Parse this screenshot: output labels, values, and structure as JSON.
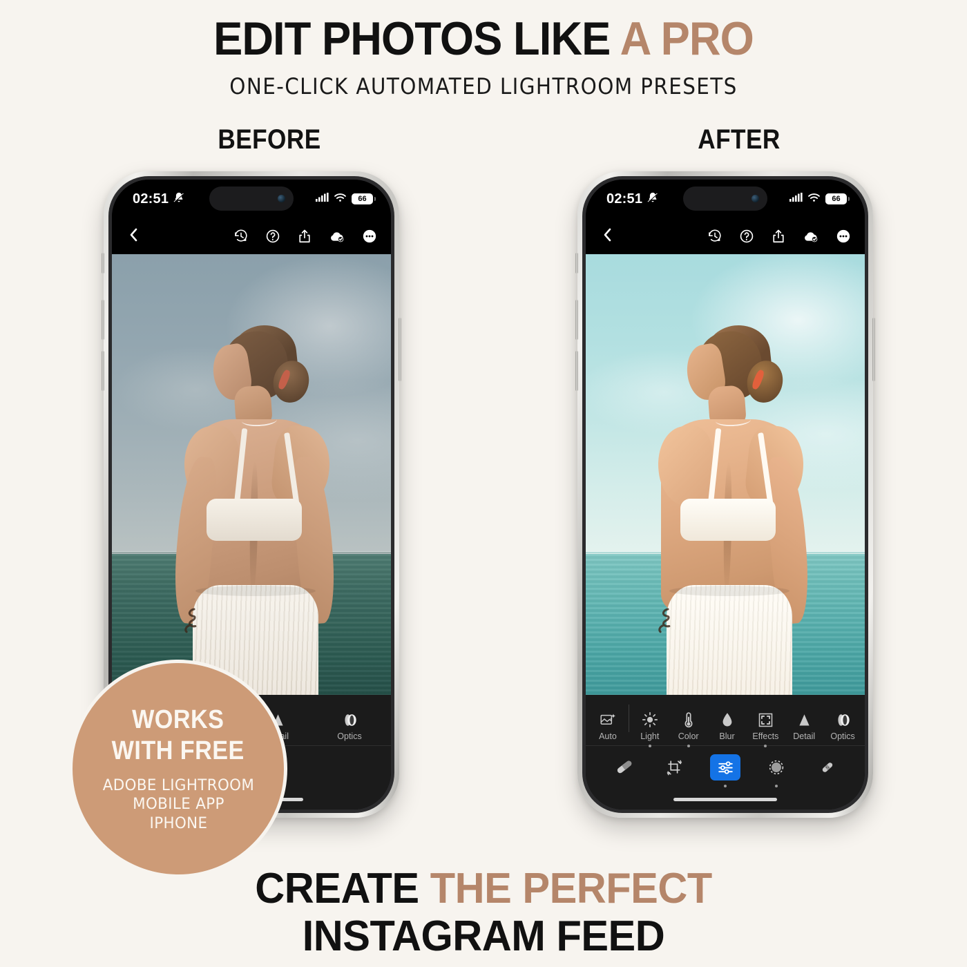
{
  "theme": {
    "background": "#F7F4EF",
    "accent_tan": "#B5866A",
    "badge_bg": "#CD9B77",
    "text_dark": "#111111",
    "lightroom_blue": "#1473E6"
  },
  "header": {
    "title_part1": "EDIT PHOTOS LIKE ",
    "title_accent": "A PRO",
    "subtitle": "ONE-CLICK AUTOMATED LIGHTROOM PRESETS"
  },
  "comparison": {
    "before_label": "BEFORE",
    "after_label": "AFTER"
  },
  "status_bar": {
    "time": "02:51",
    "silent_icon": "bell-slash-icon",
    "signal_icon": "cellular-signal-icon",
    "wifi_icon": "wifi-icon",
    "battery_percent": "66",
    "battery_level": 66
  },
  "app_bar": {
    "back_icon": "chevron-left-icon",
    "actions": [
      {
        "icon": "version-history-icon",
        "name": "version-history-button"
      },
      {
        "icon": "help-circle-icon",
        "name": "help-button"
      },
      {
        "icon": "share-icon",
        "name": "share-button"
      },
      {
        "icon": "cloud-synced-icon",
        "name": "cloud-sync-status"
      },
      {
        "icon": "more-ellipsis-icon",
        "name": "more-options-button"
      }
    ]
  },
  "editor_toolbar": {
    "tools_full": [
      {
        "label": "Auto",
        "icon": "auto-enhance-icon",
        "dot": false
      },
      {
        "label": "Light",
        "icon": "sun-icon",
        "dot": true
      },
      {
        "label": "Color",
        "icon": "thermometer-icon",
        "dot": true
      },
      {
        "label": "Blur",
        "icon": "droplet-icon",
        "dot": false
      },
      {
        "label": "Effects",
        "icon": "frame-brackets-icon",
        "dot": true
      },
      {
        "label": "Detail",
        "icon": "triangle-icon",
        "dot": false
      },
      {
        "label": "Optics",
        "icon": "lens-icon",
        "dot": false
      }
    ],
    "tools_partial": [
      {
        "label": "Effects",
        "icon": "frame-brackets-icon",
        "dot": true
      },
      {
        "label": "Detail",
        "icon": "triangle-icon",
        "dot": false
      },
      {
        "label": "Optics",
        "icon": "lens-icon",
        "dot": false
      }
    ],
    "modes_full": [
      {
        "name": "presets-button",
        "icon": "presets-icon",
        "active": false,
        "dot": false
      },
      {
        "name": "crop-button",
        "icon": "crop-rotate-icon",
        "active": false,
        "dot": false
      },
      {
        "name": "edit-button",
        "icon": "sliders-icon",
        "active": true,
        "dot": true
      },
      {
        "name": "masking-button",
        "icon": "mask-circle-icon",
        "active": false,
        "dot": true
      },
      {
        "name": "healing-button",
        "icon": "healing-brush-icon",
        "active": false,
        "dot": false
      }
    ],
    "modes_partial": [
      {
        "name": "masking-button",
        "icon": "mask-circle-icon",
        "active": false,
        "dot": true
      },
      {
        "name": "healing-button",
        "icon": "healing-brush-icon",
        "active": false,
        "dot": false
      }
    ]
  },
  "badge": {
    "line1": "WORKS",
    "line2": "WITH FREE",
    "line3": "ADOBE LIGHTROOM",
    "line4": "MOBILE APP",
    "line5": "IPHONE"
  },
  "footer": {
    "line1_part1": "CREATE ",
    "line1_accent": "THE PERFECT",
    "line2": "INSTAGRAM FEED"
  }
}
